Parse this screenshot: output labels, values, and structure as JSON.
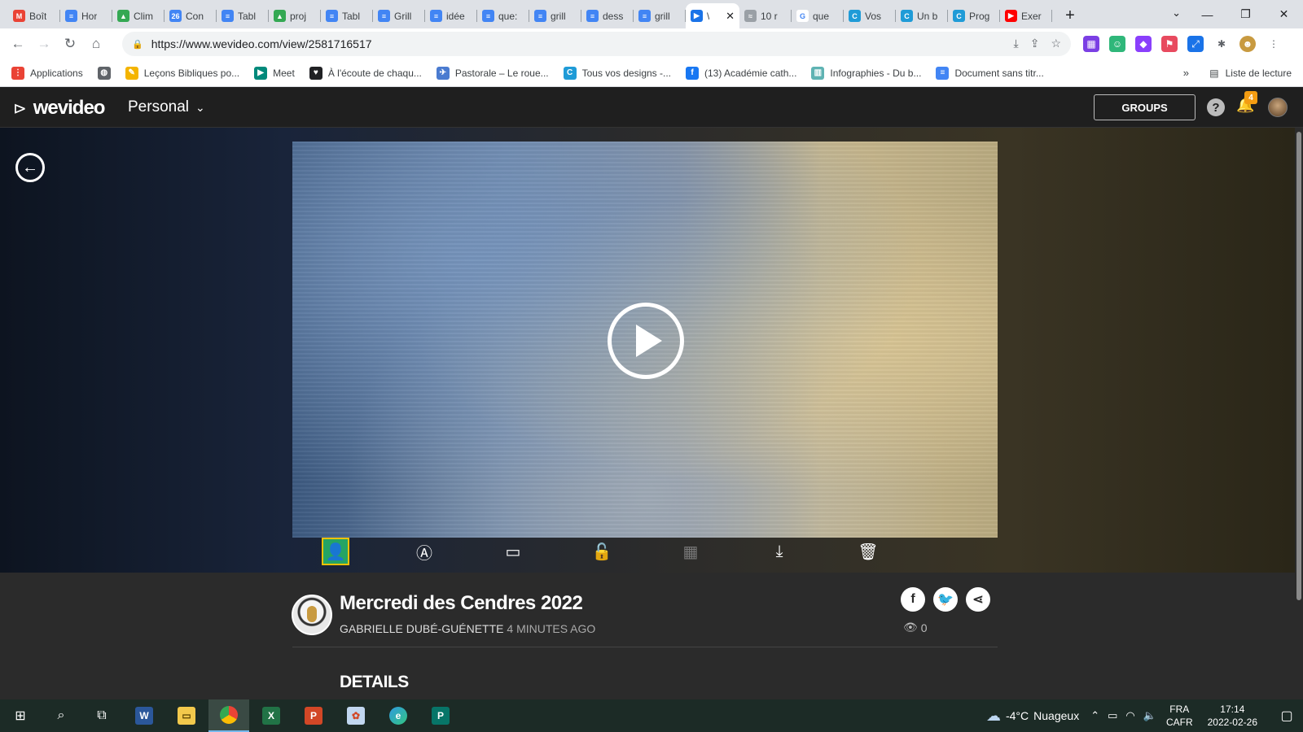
{
  "browser": {
    "tabs": [
      {
        "title": "Boît",
        "icon": "gmail-icon",
        "color": "#ea4335",
        "glyph": "M"
      },
      {
        "title": "Hor",
        "icon": "docs-icon",
        "color": "#4285f4",
        "glyph": "≡"
      },
      {
        "title": "Clim",
        "icon": "drive-icon",
        "color": "#34a853",
        "glyph": "▲"
      },
      {
        "title": "Con",
        "icon": "calendar-icon",
        "color": "#4285f4",
        "glyph": "26"
      },
      {
        "title": "Tabl",
        "icon": "docs-icon",
        "color": "#4285f4",
        "glyph": "≡"
      },
      {
        "title": "proj",
        "icon": "drive-icon",
        "color": "#34a853",
        "glyph": "▲"
      },
      {
        "title": "Tabl",
        "icon": "docs-icon",
        "color": "#4285f4",
        "glyph": "≡"
      },
      {
        "title": "Grill",
        "icon": "docs-icon",
        "color": "#4285f4",
        "glyph": "≡"
      },
      {
        "title": "idée",
        "icon": "docs-icon",
        "color": "#4285f4",
        "glyph": "≡"
      },
      {
        "title": "que:",
        "icon": "docs-icon",
        "color": "#4285f4",
        "glyph": "≡"
      },
      {
        "title": "grill",
        "icon": "docs-icon",
        "color": "#4285f4",
        "glyph": "≡"
      },
      {
        "title": "dess",
        "icon": "docs-icon",
        "color": "#4285f4",
        "glyph": "≡"
      },
      {
        "title": "grill",
        "icon": "docs-icon",
        "color": "#4285f4",
        "glyph": "≡"
      },
      {
        "title": "\\",
        "icon": "wevideo-icon",
        "color": "#1a73e8",
        "glyph": "▶",
        "active": true
      },
      {
        "title": "10 r",
        "icon": "page-icon",
        "color": "#9aa0a6",
        "glyph": "≈"
      },
      {
        "title": "que",
        "icon": "google-icon",
        "color": "#ffffff",
        "glyph": "G"
      },
      {
        "title": "Vos",
        "icon": "canva-icon",
        "color": "#1f9bd7",
        "glyph": "C"
      },
      {
        "title": "Un b",
        "icon": "canva-icon",
        "color": "#1f9bd7",
        "glyph": "C"
      },
      {
        "title": "Prog",
        "icon": "canva-icon",
        "color": "#1f9bd7",
        "glyph": "C"
      },
      {
        "title": "Exer",
        "icon": "youtube-icon",
        "color": "#ff0000",
        "glyph": "▶"
      }
    ],
    "url": "https://www.wevideo.com/view/2581716517",
    "bookmarks": [
      {
        "label": "Applications",
        "icon": "apps-grid-icon",
        "color": "#ea4335",
        "glyph": "⋮"
      },
      {
        "label": "",
        "icon": "globe-icon",
        "color": "#5f6368",
        "glyph": "◍"
      },
      {
        "label": "Leçons Bibliques po...",
        "icon": "pencil-icon",
        "color": "#f4b400",
        "glyph": "✎"
      },
      {
        "label": "Meet",
        "icon": "meet-icon",
        "color": "#00897b",
        "glyph": "▶"
      },
      {
        "label": "À l'écoute de chaqu...",
        "icon": "heart-icon",
        "color": "#202124",
        "glyph": "♥"
      },
      {
        "label": "Pastorale – Le roue...",
        "icon": "bird-icon",
        "color": "#4a7bd0",
        "glyph": "✈"
      },
      {
        "label": "Tous vos designs -...",
        "icon": "canva-icon",
        "color": "#1f9bd7",
        "glyph": "C"
      },
      {
        "label": "(13) Académie cath...",
        "icon": "facebook-icon",
        "color": "#1877f2",
        "glyph": "f"
      },
      {
        "label": "Infographies - Du b...",
        "icon": "infographic-icon",
        "color": "#5fb3b3",
        "glyph": "▥"
      },
      {
        "label": "Document sans titr...",
        "icon": "docs-icon",
        "color": "#4285f4",
        "glyph": "≡"
      }
    ],
    "more": "»",
    "reading_list": "Liste de lecture"
  },
  "wevideo": {
    "brand": "wevideo",
    "workspace": "Personal",
    "groups_label": "GROUPS",
    "help": "?",
    "notifications": "4"
  },
  "video": {
    "title": "Mercredi des Cendres 2022",
    "author": "GABRIELLE DUBÉ-GUÉNETTE",
    "time": "4 MINUTES AGO",
    "views": "0",
    "details_heading": "DETAILS"
  },
  "actions": [
    {
      "name": "google-classroom-share-button",
      "glyph": "👤",
      "icon": "classroom-icon"
    },
    {
      "name": "edit-title-button",
      "glyph": "Ⓐ",
      "icon": "text-icon"
    },
    {
      "name": "embed-button",
      "glyph": "▭",
      "icon": "monitor-icon"
    },
    {
      "name": "privacy-toggle-button",
      "glyph": "🔓",
      "icon": "unlock-icon"
    },
    {
      "name": "storyboard-button",
      "glyph": "▦",
      "icon": "film-icon"
    },
    {
      "name": "download-button",
      "glyph": "⤓",
      "icon": "download-icon"
    },
    {
      "name": "delete-button",
      "glyph": "🗑",
      "icon": "trash-icon"
    }
  ],
  "taskbar": {
    "weather_temp": "-4°C",
    "weather_desc": "Nuageux",
    "lang1": "FRA",
    "lang2": "CAFR",
    "time": "17:14",
    "date": "2022-02-26"
  }
}
